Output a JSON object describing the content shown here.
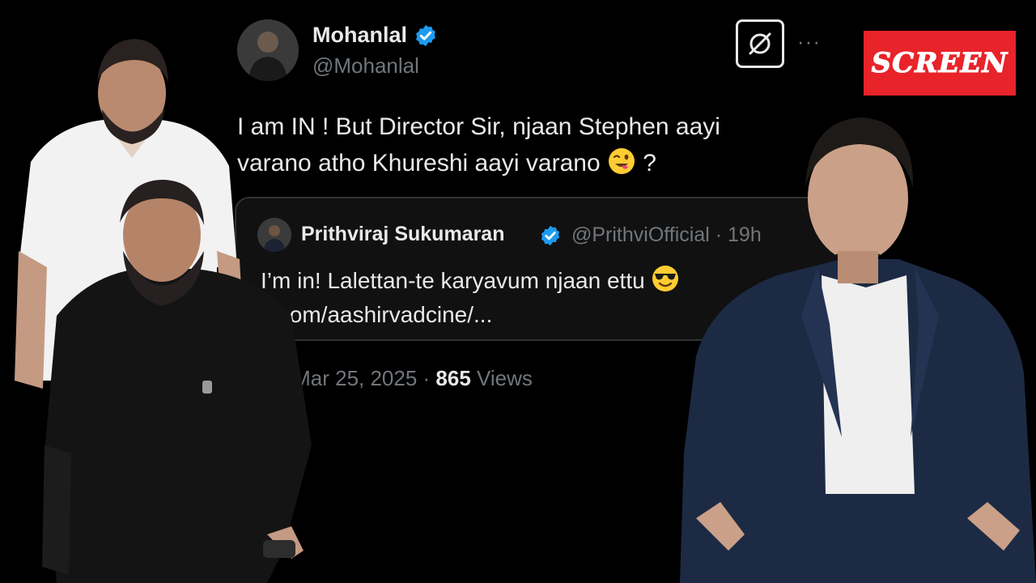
{
  "tweet": {
    "display_name": "Mohanlal",
    "handle": "@Mohanlal",
    "text": "I am IN ! But Director Sir, njaan Stephen aayi varano atho Khureshi aayi varano",
    "text_suffix": " ?",
    "emoji_icon": "winking-face-with-tongue-icon",
    "verified_icon": "verified-badge-icon",
    "more_icon": "more-options-icon",
    "more_label": "···",
    "grok_icon": "grok-icon",
    "quote": {
      "display_name": "Prithviraj Sukumaran",
      "handle_time": "@PrithviOfficial · 19h",
      "text": "I’m in! Lalettan-te karyavum njaan ettu",
      "emoji_icon": "smiling-face-with-sunglasses-icon",
      "link": "x.com/aashirvadcine/..."
    },
    "meta": {
      "time_date": "AM · Mar 25, 2025 · ",
      "views_count": "865",
      "views_label": " Views"
    }
  },
  "logo": {
    "text": "SCREEN",
    "color": "#e8232a"
  },
  "colors": {
    "background": "#000000",
    "primary_text": "#e7e9ea",
    "secondary_text": "#71767b",
    "verified_blue": "#1d9bf0"
  }
}
